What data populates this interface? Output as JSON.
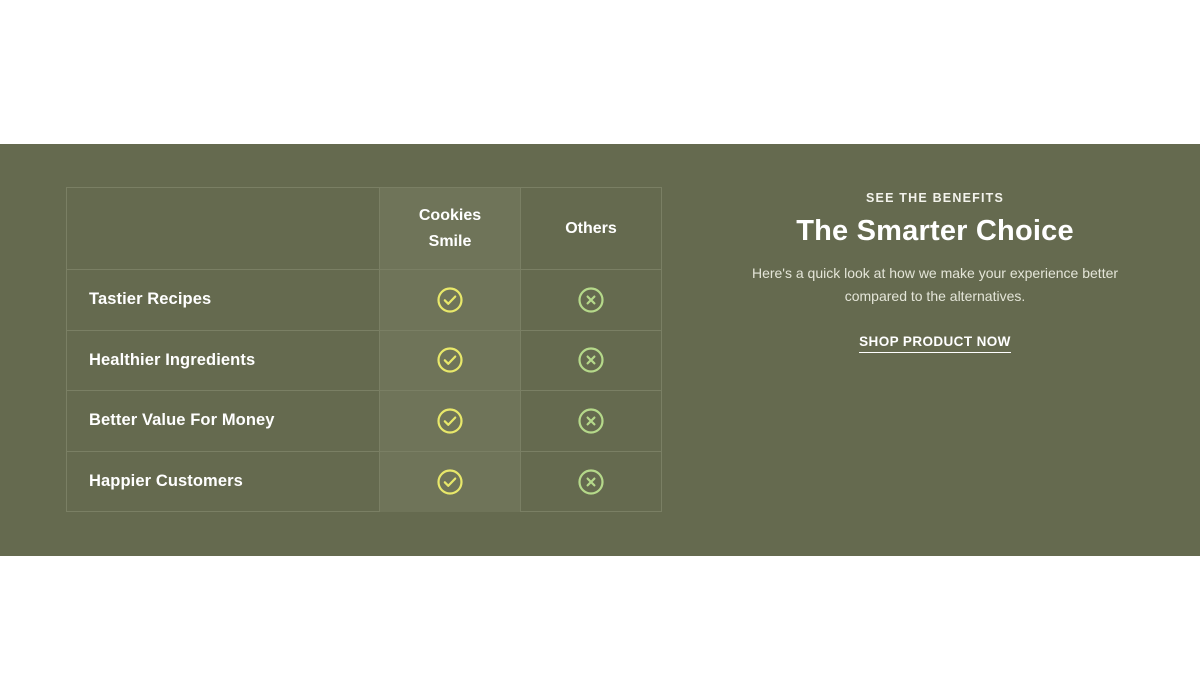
{
  "comparison": {
    "headers": {
      "ours": "Cookies Smile",
      "others": "Others"
    },
    "rows": [
      {
        "label": "Tastier Recipes",
        "ours_icon": "check-circle-icon",
        "others_icon": "x-circle-icon"
      },
      {
        "label": "Healthier Ingredients",
        "ours_icon": "check-circle-icon",
        "others_icon": "x-circle-icon"
      },
      {
        "label": "Better Value For Money",
        "ours_icon": "check-circle-icon",
        "others_icon": "x-circle-icon"
      },
      {
        "label": "Happier Customers",
        "ours_icon": "check-circle-icon",
        "others_icon": "x-circle-icon"
      }
    ]
  },
  "benefits": {
    "eyebrow": "SEE THE BENEFITS",
    "title": "The Smarter Choice",
    "description": "Here's a quick look at how we make your experience better compared to the alternatives.",
    "cta_label": "SHOP PRODUCT NOW"
  },
  "colors": {
    "band": "#656a4f",
    "ours_column": "#6f7459",
    "check": "#e8e86a",
    "cross": "#b5d98a"
  }
}
